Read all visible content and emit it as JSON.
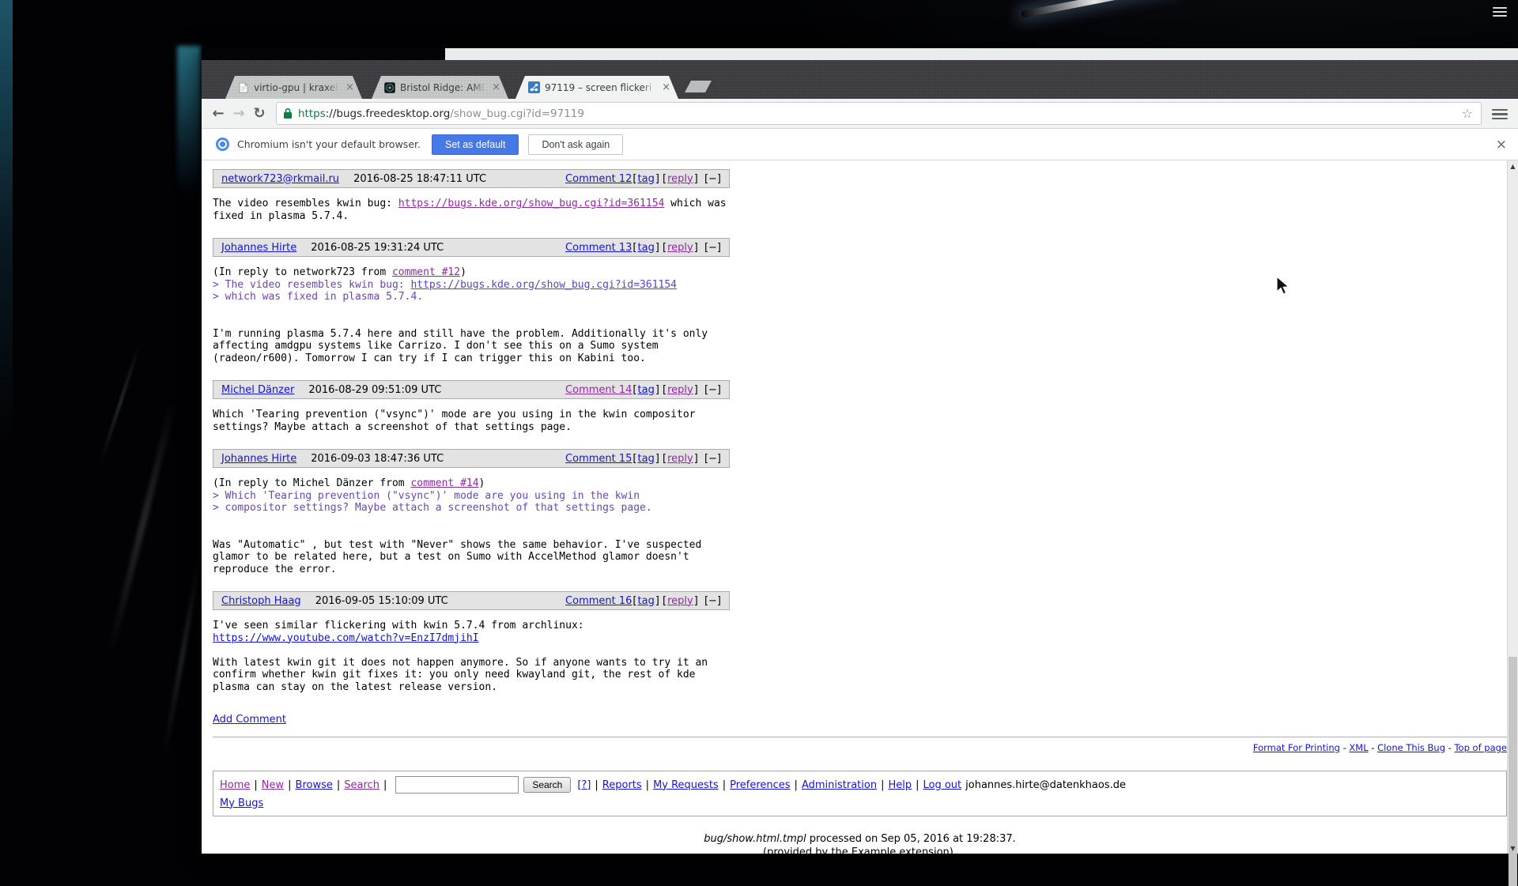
{
  "desktop": {
    "panel_menu_icon": "hamburger"
  },
  "browser": {
    "tabs": [
      {
        "title": "virtio-gpu | kraxel's ne",
        "favicon": "page-icon",
        "active": false
      },
      {
        "title": "Bristol Ridge: AMD ve",
        "favicon": "chip-icon",
        "active": false
      },
      {
        "title": "97119 – screen flickeri",
        "favicon": "bugzilla-icon",
        "active": true
      }
    ],
    "close_tab_icon": "×",
    "url": {
      "scheme": "https",
      "host": "://bugs.freedesktop.org",
      "path": "/show_bug.cgi?id=97119"
    },
    "toolbar_icons": {
      "back": "←",
      "forward": "→",
      "reload": "↻",
      "bookmark_star": "☆"
    },
    "infobar": {
      "message": "Chromium isn't your default browser.",
      "set_default_label": "Set as default",
      "dont_ask_label": "Don't ask again",
      "close_icon": "×"
    },
    "colors": {
      "accent_blue": "#4678e6",
      "https_green": "#0b8043",
      "link_blue": "#1414cc",
      "link_visited": "#8e2a9e",
      "quote_violet": "#6b46b0"
    }
  },
  "page": {
    "labels": {
      "tag": "tag",
      "reply": "reply",
      "collapse": "[−]",
      "bracket_open": "[",
      "bracket_close": "]"
    },
    "comments": [
      {
        "author": "network723@rkmail.ru",
        "author_visited": false,
        "date": "2016-08-25 18:47:11 UTC",
        "number": "Comment 12",
        "number_visited": false,
        "lines": [
          {
            "q": 0,
            "parts": [
              {
                "t": "The video resembles kwin bug: "
              },
              {
                "t": "https://bugs.kde.org/show_bug.cgi?id=361154",
                "c": "purple",
                "u": 1
              },
              {
                "t": " which was"
              }
            ]
          },
          {
            "q": 0,
            "parts": [
              {
                "t": "fixed in plasma 5.7.4."
              }
            ]
          }
        ]
      },
      {
        "author": "Johannes Hirte",
        "author_visited": false,
        "date": "2016-08-25 19:31:24 UTC",
        "number": "Comment 13",
        "number_visited": false,
        "lines": [
          {
            "q": 0,
            "parts": [
              {
                "t": "(In reply to network723 from "
              },
              {
                "t": "comment #12",
                "c": "purple",
                "u": 1
              },
              {
                "t": ")"
              }
            ]
          },
          {
            "q": 1,
            "parts": [
              {
                "t": "> The video resembles kwin bug: "
              },
              {
                "t": "https://bugs.kde.org/show_bug.cgi?id=361154",
                "c": "qlink",
                "u": 1
              }
            ]
          },
          {
            "q": 1,
            "parts": [
              {
                "t": "> which was fixed in plasma 5.7.4."
              }
            ]
          },
          {
            "q": 0,
            "parts": []
          },
          {
            "q": 0,
            "parts": []
          },
          {
            "q": 0,
            "parts": [
              {
                "t": "I'm running plasma 5.7.4 here and still have the problem. Additionally it's only"
              }
            ]
          },
          {
            "q": 0,
            "parts": [
              {
                "t": "affecting amdgpu systems like Carrizo. I don't see this on a Sumo system"
              }
            ]
          },
          {
            "q": 0,
            "parts": [
              {
                "t": "(radeon/r600). Tomorrow I can try if I can trigger this on Kabini too."
              }
            ]
          }
        ]
      },
      {
        "author": "Michel Dänzer",
        "author_visited": false,
        "date": "2016-08-29 09:51:09 UTC",
        "number": "Comment 14",
        "number_visited": true,
        "lines": [
          {
            "q": 0,
            "parts": [
              {
                "t": "Which 'Tearing prevention (\"vsync\")' mode are you using in the kwin compositor"
              }
            ]
          },
          {
            "q": 0,
            "parts": [
              {
                "t": "settings? Maybe attach a screenshot of that settings page."
              }
            ]
          }
        ]
      },
      {
        "author": "Johannes Hirte",
        "author_visited": false,
        "date": "2016-09-03 18:47:36 UTC",
        "number": "Comment 15",
        "number_visited": false,
        "lines": [
          {
            "q": 0,
            "parts": [
              {
                "t": "(In reply to Michel Dänzer from "
              },
              {
                "t": "comment #14",
                "c": "purple",
                "u": 1
              },
              {
                "t": ")"
              }
            ]
          },
          {
            "q": 1,
            "parts": [
              {
                "t": "> Which 'Tearing prevention (\"vsync\")' mode are you using in the kwin"
              }
            ]
          },
          {
            "q": 1,
            "parts": [
              {
                "t": "> compositor settings? Maybe attach a screenshot of that settings page."
              }
            ]
          },
          {
            "q": 0,
            "parts": []
          },
          {
            "q": 0,
            "parts": []
          },
          {
            "q": 0,
            "parts": [
              {
                "t": "Was \"Automatic\" , but test with \"Never\" shows the same behavior. I've suspected"
              }
            ]
          },
          {
            "q": 0,
            "parts": [
              {
                "t": "glamor to be related here, but a test on Sumo with AccelMethod glamor doesn't"
              }
            ]
          },
          {
            "q": 0,
            "parts": [
              {
                "t": "reproduce the error."
              }
            ]
          }
        ]
      },
      {
        "author": "Christoph Haag",
        "author_visited": false,
        "date": "2016-09-05 15:10:09 UTC",
        "number": "Comment 16",
        "number_visited": false,
        "lines": [
          {
            "q": 0,
            "parts": [
              {
                "t": "I've seen similar flickering with kwin 5.7.4 from archlinux:"
              }
            ]
          },
          {
            "q": 0,
            "parts": [
              {
                "t": "https://www.youtube.com/watch?v=EnzI7dmjihI",
                "c": "blue",
                "u": 1
              }
            ]
          },
          {
            "q": 0,
            "parts": []
          },
          {
            "q": 0,
            "parts": [
              {
                "t": "With latest kwin git it does not happen anymore. So if anyone wants to try it an"
              }
            ]
          },
          {
            "q": 0,
            "parts": [
              {
                "t": "confirm whether kwin git fixes it: you only need kwayland git, the rest of kde"
              }
            ]
          },
          {
            "q": 0,
            "parts": [
              {
                "t": "plasma can stay on the latest release version."
              }
            ]
          }
        ]
      }
    ],
    "add_comment": "Add Comment",
    "actions": [
      "Format For Printing",
      "XML",
      "Clone This Bug",
      "Top of page"
    ],
    "actions_separator": " - ",
    "footer": {
      "links_before": [
        {
          "label": "Home",
          "visited": true
        },
        {
          "label": "New",
          "visited": true
        },
        {
          "label": "Browse",
          "visited": false
        },
        {
          "label": "Search",
          "visited": true
        }
      ],
      "search_value": "",
      "search_button": "Search",
      "help_link": "[?]",
      "links_after": [
        {
          "label": "Reports",
          "visited": false
        },
        {
          "label": "My Requests",
          "visited": false
        },
        {
          "label": "Preferences",
          "visited": false
        },
        {
          "label": "Administration",
          "visited": false
        },
        {
          "label": "Help",
          "visited": false
        },
        {
          "label": "Log out",
          "visited": false
        }
      ],
      "user_email": "johannes.hirte@datenkhaos.de",
      "my_bugs": "My Bugs"
    },
    "processed": {
      "file": "bug/show.html.tmpl",
      "rest": " processed on Sep 05, 2016 at 19:28:37.",
      "provided": "(provided by the Example extension)."
    }
  }
}
